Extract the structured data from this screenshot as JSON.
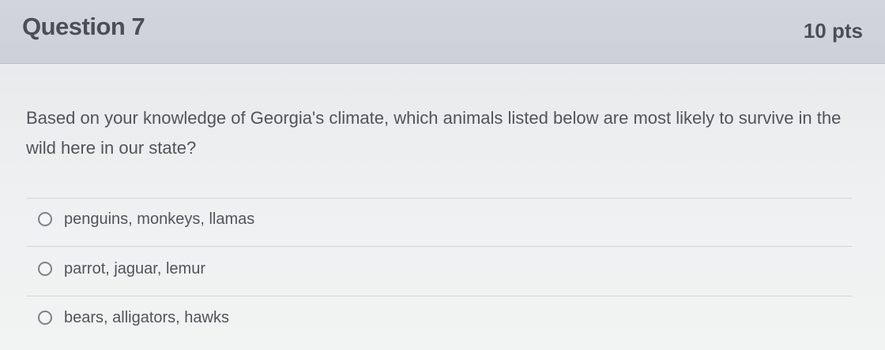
{
  "question": {
    "title": "Question 7",
    "points": "10 pts",
    "text": "Based on your knowledge of Georgia's climate, which animals listed below are most likely to survive in the wild here in our state?"
  },
  "answers": [
    {
      "label": "penguins, monkeys, llamas",
      "selected": false
    },
    {
      "label": "parrot, jaguar, lemur",
      "selected": false
    },
    {
      "label": "bears, alligators, hawks",
      "selected": false
    }
  ]
}
